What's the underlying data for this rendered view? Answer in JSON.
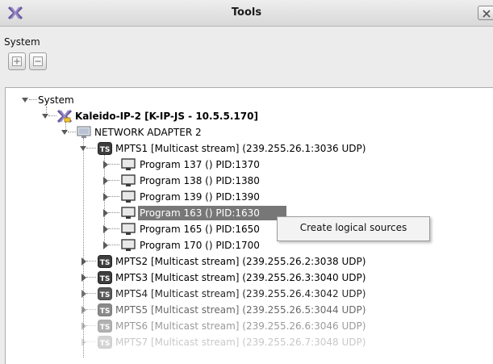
{
  "window": {
    "title": "Tools",
    "accent_color": "#5a4a8a"
  },
  "toolbar": {
    "section_label": "System",
    "add_icon": "plus-icon",
    "remove_icon": "minus-icon"
  },
  "tree": {
    "root": {
      "label": "System"
    },
    "device": {
      "label": "Kaleido-IP-2 [K-IP-JS - 10.5.5.170]"
    },
    "adapter": {
      "label": "NETWORK ADAPTER 2"
    },
    "mpts1": {
      "label": "MPTS1 [Multicast stream] (239.255.26.1:3036 UDP)"
    },
    "programs": [
      {
        "label": "Program 137 () PID:1370"
      },
      {
        "label": "Program 138 () PID:1380"
      },
      {
        "label": "Program 139 () PID:1390"
      },
      {
        "label": "Program 163 () PID:1630",
        "selected": true
      },
      {
        "label": "Program 165 () PID:1650"
      },
      {
        "label": "Program 170 () PID:1700"
      }
    ],
    "streams": [
      {
        "label": "MPTS2 [Multicast stream] (239.255.26.2:3038 UDP)"
      },
      {
        "label": "MPTS3 [Multicast stream] (239.255.26.3:3040 UDP)"
      },
      {
        "label": "MPTS4 [Multicast stream] (239.255.26.4:3042 UDP)"
      },
      {
        "label": "MPTS5 [Multicast stream] (239.255.26.5:3044 UDP)"
      },
      {
        "label": "MPTS6 [Multicast stream] (239.255.26.6:3046 UDP)"
      },
      {
        "label": "MPTS7 [Multicast stream] (239.255.26.7:3048 UDP)"
      }
    ],
    "ts_badge": "TS"
  },
  "context_menu": {
    "items": [
      {
        "label": "Create logical sources"
      }
    ]
  }
}
